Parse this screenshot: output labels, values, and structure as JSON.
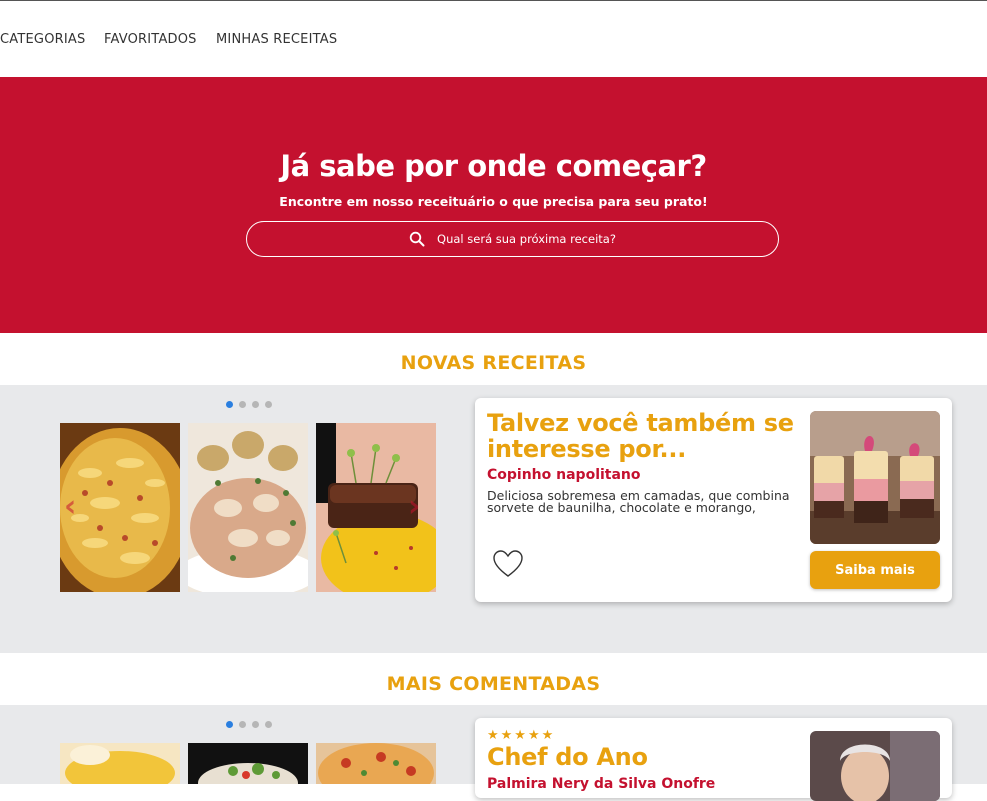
{
  "nav": {
    "items": [
      "CATEGORIAS",
      "FAVORITADOS",
      "MINHAS RECEITAS"
    ]
  },
  "hero": {
    "title": "Já sabe por onde começar?",
    "subtitle": "Encontre em nosso receituário o que precisa para seu prato!",
    "search_placeholder": "Qual será sua próxima receita?"
  },
  "sections": {
    "new": {
      "title": "NOVAS RECEITAS",
      "carousel_pages": 4,
      "carousel_active": 1,
      "images": [
        "gratin-photo",
        "chicken-stroganoff-photo",
        "steak-risotto-photo"
      ],
      "card": {
        "title": "Talvez você também se interesse por...",
        "recipe_name": "Copinho napolitano",
        "description": "Deliciosa sobremesa em camadas, que combina sorvete de baunilha, chocolate e morango,",
        "button": "Saiba mais",
        "image": "dessert-cups-photo"
      }
    },
    "commented": {
      "title": "MAIS COMENTADAS",
      "carousel_pages": 4,
      "carousel_active": 1,
      "card": {
        "stars": "★★★★★",
        "title": "Chef do Ano",
        "name": "Palmira Nery da Silva Onofre"
      }
    }
  },
  "colors": {
    "brand_red": "#c4112f",
    "accent_orange": "#e8a10f",
    "band_gray": "#e8e9eb",
    "dot_active": "#2a7fe0"
  }
}
